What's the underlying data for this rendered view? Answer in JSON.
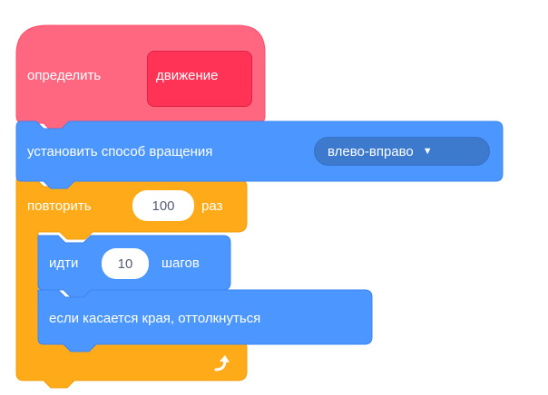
{
  "define_block": {
    "label": "определить",
    "custom_block_name": "движение"
  },
  "rotation_block": {
    "label": "установить способ вращения",
    "dropdown_value": "влево-вправо"
  },
  "repeat_block": {
    "label_before": "повторить",
    "count": "100",
    "label_after": "раз"
  },
  "move_block": {
    "label_before": "идти",
    "steps": "10",
    "label_after": "шагов"
  },
  "bounce_block": {
    "label": "если касается края, оттолкнуться"
  },
  "icons": {
    "loop_arrow": "loop-arrow-icon",
    "dropdown_caret": "dropdown-caret-icon"
  },
  "colors": {
    "events_pink": "#ff6680",
    "motion_blue": "#4c97ff",
    "control_orange": "#ffab19",
    "input_text": "#575e75"
  }
}
